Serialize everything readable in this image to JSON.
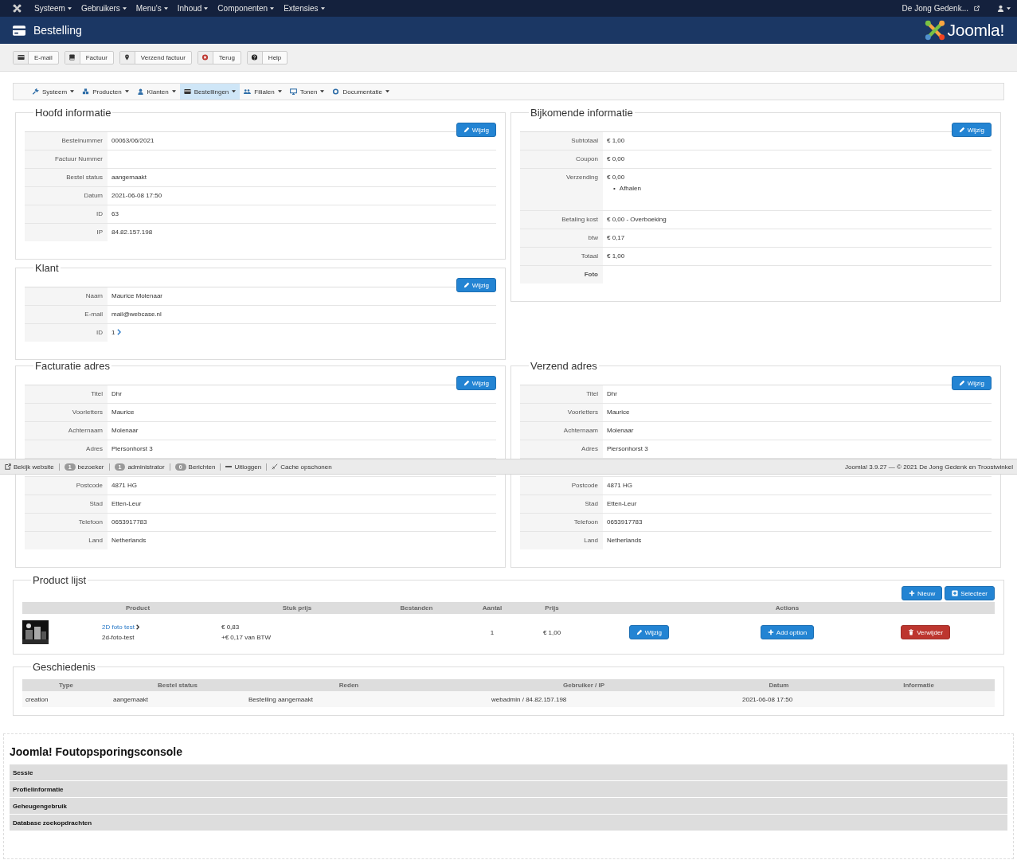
{
  "topnav": {
    "items": [
      "Systeem",
      "Gebruikers",
      "Menu's",
      "Inhoud",
      "Componenten",
      "Extensies"
    ],
    "site": "De Jong Gedenk..."
  },
  "header": {
    "title": "Bestelling",
    "logo": "Joomla!"
  },
  "toolbar": [
    "E-mail",
    "Factuur",
    "Verzend factuur",
    "Terug",
    "Help"
  ],
  "submenu": [
    {
      "label": "Systeem",
      "selected": false
    },
    {
      "label": "Producten",
      "selected": false
    },
    {
      "label": "Klanten",
      "selected": false
    },
    {
      "label": "Bestellingen",
      "selected": true
    },
    {
      "label": "Filialen",
      "selected": false
    },
    {
      "label": "Tonen",
      "selected": false
    },
    {
      "label": "Documentatie",
      "selected": false
    }
  ],
  "hoofd_informatie": {
    "title": "Hoofd informatie",
    "button": "Wijzig",
    "rows": [
      {
        "label": "Bestelnummer",
        "value": "00063/06/2021"
      },
      {
        "label": "Factuur Nummer"
      },
      {
        "label": "Bestel status",
        "value": "aangemaakt"
      },
      {
        "label": "Datum",
        "value": "2021-06-08 17:50"
      },
      {
        "label": "ID",
        "value": "63"
      },
      {
        "label": "IP",
        "value": "84.82.157.198"
      }
    ]
  },
  "klant": {
    "title": "Klant",
    "button": "Wijzig",
    "rows": [
      {
        "label": "Naam",
        "value": "Maurice Molenaar"
      },
      {
        "label": "E-mail",
        "value": "mail@webcase.nl"
      },
      {
        "label": "ID",
        "value": "1",
        "kind": "link"
      }
    ]
  },
  "bijkomende_informatie": {
    "title": "Bijkomende informatie",
    "button": "Wijzig",
    "rows": [
      {
        "label": "Subtotaal",
        "value": "€ 1,00"
      },
      {
        "label": "Coupon",
        "value": "€ 0,00"
      },
      {
        "label": "Verzending",
        "value": "€ 0,00",
        "bullet": "•",
        "list": [
          "Afhalen"
        ]
      },
      {
        "label": "Betaling kost",
        "value": "€ 0,00 - Overboeking"
      },
      {
        "label": "btw",
        "value": "€ 0,17"
      },
      {
        "label": "Totaal",
        "value": "€ 1,00"
      },
      {
        "label": "Foto",
        "bold": true
      }
    ]
  },
  "facturatie_adres": {
    "title": "Facturatie adres",
    "button": "Wijzig",
    "rows": [
      {
        "label": "Titel",
        "value": "Dhr"
      },
      {
        "label": "Voorletters",
        "value": "Maurice"
      },
      {
        "label": "Achternaam",
        "value": "Molenaar"
      },
      {
        "label": "Adres",
        "value": "Piersonhorst 3"
      },
      {
        "label": "Postcode",
        "value": "4871 HG"
      },
      {
        "label": "Stad",
        "value": "Etten-Leur"
      },
      {
        "label": "Telefoon",
        "value": "0653917783"
      },
      {
        "label": "Land",
        "value": "Netherlands"
      }
    ]
  },
  "verzend_adres": {
    "title": "Verzend adres",
    "button": "Wijzig",
    "rows": [
      {
        "label": "Titel",
        "value": "Dhr"
      },
      {
        "label": "Voorletters",
        "value": "Maurice"
      },
      {
        "label": "Achternaam",
        "value": "Molenaar"
      },
      {
        "label": "Adres",
        "value": "Piersonhorst 3"
      },
      {
        "label": "Postcode",
        "value": "4871 HG"
      },
      {
        "label": "Stad",
        "value": "Etten-Leur"
      },
      {
        "label": "Telefoon",
        "value": "0653917783"
      },
      {
        "label": "Land",
        "value": "Netherlands"
      }
    ]
  },
  "status_bar": {
    "items": [
      {
        "label": "Bekijk website"
      },
      {
        "count": "1",
        "label": "bezoeker"
      },
      {
        "count": "1",
        "label": "administrator"
      },
      {
        "count": "0",
        "label": "Berichten"
      },
      {
        "label": "Uitloggen"
      },
      {
        "label": "Cache opschonen"
      }
    ],
    "right": "Joomla! 3.9.27 — © 2021 De Jong Gedenk en Troostwinkel"
  },
  "product_lijst": {
    "title": "Product lijst",
    "buttons": [
      "Nieuw",
      "Selecteer"
    ],
    "columns": [
      "Product",
      "Stuk prijs",
      "Bestanden",
      "Aantal",
      "Prijs",
      "Actions"
    ],
    "rows": [
      {
        "image": {
          "kind": "picture"
        },
        "name": "2D foto test",
        "alias": "2d-foto-test",
        "unit_price": "€ 0,83",
        "tax": "+€ 0,17 van BTW",
        "quantity": "1",
        "price": "€ 1,00",
        "actions": [
          "Wijzig",
          "Add option",
          "Verwijder"
        ]
      }
    ]
  },
  "geschiedenis": {
    "title": "Geschiedenis",
    "columns": [
      "Type",
      "Bestel status",
      "Reden",
      "Gebruiker / IP",
      "Datum",
      "Informatie"
    ],
    "rows": [
      [
        "creation",
        "aangemaakt",
        "Bestelling aangemaakt",
        "webadmin / 84.82.157.198",
        "2021-06-08 17:50"
      ]
    ]
  },
  "debug_console": {
    "title": "Joomla! Foutopsporingsconsole",
    "sections": [
      "Sessie",
      "Profielinformatie",
      "Geheugengebruik",
      "Database zoekopdrachten"
    ]
  }
}
